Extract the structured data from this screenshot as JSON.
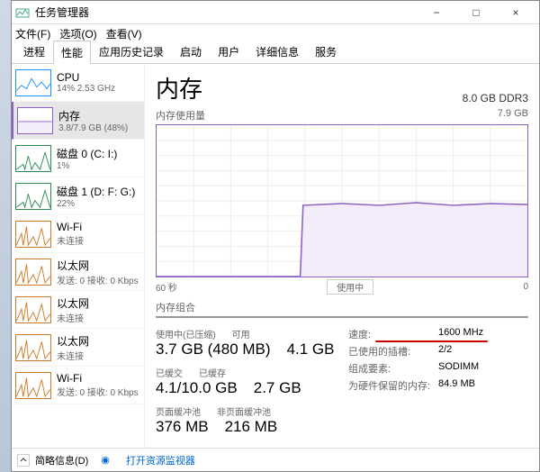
{
  "window": {
    "title": "任务管理器",
    "min_tip": "−",
    "max_tip": "□",
    "close_tip": "×"
  },
  "menu": {
    "file": "文件(F)",
    "options": "选项(O)",
    "view": "查看(V)"
  },
  "tabs": [
    "进程",
    "性能",
    "应用历史记录",
    "启动",
    "用户",
    "详细信息",
    "服务"
  ],
  "active_tab": 1,
  "sidebar": {
    "items": [
      {
        "name": "CPU",
        "sub": "14%  2.53 GHz",
        "color": "#1e90ff",
        "kind": "cpu"
      },
      {
        "name": "内存",
        "sub": "3.8/7.9 GB (48%)",
        "color": "#8a5fc0",
        "kind": "mem",
        "selected": true
      },
      {
        "name": "磁盘 0 (C: I:)",
        "sub": "1%",
        "color": "#2e8b57",
        "kind": "disk"
      },
      {
        "name": "磁盘 1 (D: F: G:)",
        "sub": "22%",
        "color": "#2e8b57",
        "kind": "disk"
      },
      {
        "name": "Wi-Fi",
        "sub": "未连接",
        "color": "#cc7a29",
        "kind": "net"
      },
      {
        "name": "以太网",
        "sub": "发送: 0  接收: 0 Kbps",
        "color": "#cc7a29",
        "kind": "net"
      },
      {
        "name": "以太网",
        "sub": "未连接",
        "color": "#cc7a29",
        "kind": "net"
      },
      {
        "name": "以太网",
        "sub": "未连接",
        "color": "#cc7a29",
        "kind": "net"
      },
      {
        "name": "Wi-Fi",
        "sub": "发送: 0  接收: 0 Kbps",
        "color": "#cc7a29",
        "kind": "net"
      }
    ]
  },
  "main": {
    "title": "内存",
    "rhs": "8.0 GB DDR3",
    "usage_label": "内存使用量",
    "usage_max": "7.9 GB",
    "x_left": "60 秒",
    "x_mid": "使用中",
    "x_right": "0",
    "comp_label": "内存组合",
    "stats_left": [
      {
        "labels": [
          "使用中(已压缩)",
          "可用"
        ],
        "values": [
          "3.7 GB (480 MB)",
          "4.1 GB"
        ]
      },
      {
        "labels": [
          "已缓交",
          "已缓存"
        ],
        "values": [
          "4.1/10.0 GB",
          "2.7 GB"
        ]
      },
      {
        "labels": [
          "页面缓冲池",
          "非页面缓冲池"
        ],
        "values": [
          "376 MB",
          "216 MB"
        ]
      }
    ],
    "stats_right": [
      {
        "k": "速度:",
        "v": "1600 MHz",
        "hl": true
      },
      {
        "k": "已使用的插槽:",
        "v": "2/2"
      },
      {
        "k": "组成要素:",
        "v": "SODIMM"
      },
      {
        "k": "为硬件保留的内存:",
        "v": "84.9 MB"
      }
    ]
  },
  "footer": {
    "less": "简略信息(D)",
    "link": "打开资源监视器"
  },
  "chart_data": {
    "type": "area",
    "title": "内存使用量",
    "ylabel": "GB",
    "ylim": [
      0,
      7.9
    ],
    "xrange_seconds": [
      60,
      0
    ],
    "series": [
      {
        "name": "内存",
        "color": "#8a5fc0",
        "x": [
          60,
          55,
          50,
          45,
          40,
          37,
          35,
          30,
          25,
          20,
          15,
          10,
          5,
          0
        ],
        "y": [
          0,
          0,
          0,
          0,
          0,
          0,
          3.7,
          3.8,
          3.7,
          3.8,
          3.7,
          3.8,
          3.7,
          3.7
        ]
      }
    ]
  }
}
